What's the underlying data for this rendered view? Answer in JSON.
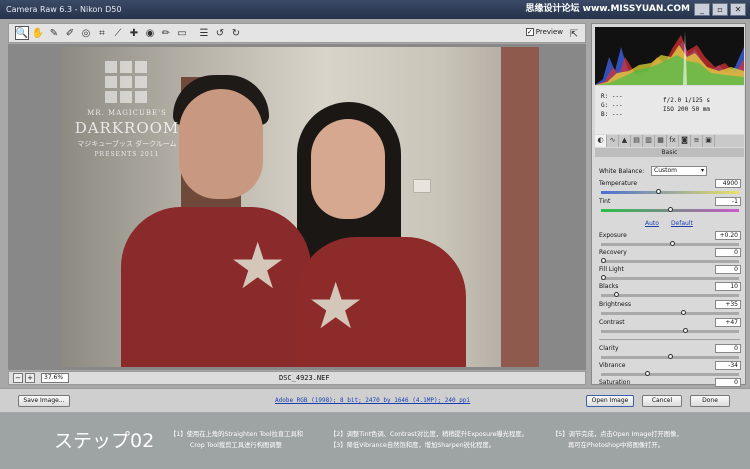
{
  "window": {
    "title": "Camera Raw 6.3  -  Nikon D50",
    "watermark": "思缘设计论坛 www.MISSYUAN.COM",
    "close": "✕",
    "minimize": "_",
    "maximize": "▫"
  },
  "toolbar": {
    "tools": [
      "zoom-icon",
      "hand-icon",
      "white-balance-icon",
      "color-sampler-icon",
      "target-adjust-icon",
      "crop-icon",
      "straighten-icon",
      "spot-removal-icon",
      "red-eye-icon",
      "adjustment-brush-icon",
      "graduated-filter-icon",
      "preferences-icon",
      "rotate-ccw-icon",
      "rotate-cw-icon"
    ],
    "preview_label": "Preview",
    "preview_checked": true
  },
  "photo_logo": {
    "line1": "MR. MAGICUBE'S",
    "line2": "DARKROOM",
    "line3": "マジキューブッス ダークルーム",
    "line4": "PRESENTS 2011"
  },
  "statusbar": {
    "zoom": "37.6%",
    "filename": "DSC_4923.NEF"
  },
  "readout": {
    "r": "R:  ---",
    "g": "G:  ---",
    "b": "B:  ---",
    "aperture_shutter": "f/2.0   1/125 s",
    "iso_focal": "ISO 200   50 mm"
  },
  "panel": {
    "section": "Basic",
    "white_balance_label": "White Balance:",
    "white_balance_value": "Custom",
    "auto": "Auto",
    "default": "Default",
    "controls": [
      {
        "label": "Temperature",
        "value": "4900",
        "pos": 0.41
      },
      {
        "label": "Tint",
        "value": "-1",
        "pos": 0.5
      },
      {
        "label": "Exposure",
        "value": "+0.20",
        "pos": 0.52
      },
      {
        "label": "Recovery",
        "value": "0",
        "pos": 0.0
      },
      {
        "label": "Fill Light",
        "value": "0",
        "pos": 0.0
      },
      {
        "label": "Blacks",
        "value": "10",
        "pos": 0.1
      },
      {
        "label": "Brightness",
        "value": "+35",
        "pos": 0.6
      },
      {
        "label": "Contrast",
        "value": "+47",
        "pos": 0.62
      },
      {
        "label": "Clarity",
        "value": "0",
        "pos": 0.5
      },
      {
        "label": "Vibrance",
        "value": "-34",
        "pos": 0.33
      },
      {
        "label": "Saturation",
        "value": "0",
        "pos": 0.5
      }
    ]
  },
  "buttons": {
    "save": "Save Image...",
    "open": "Open Image",
    "cancel": "Cancel",
    "done": "Done"
  },
  "workflow_link": "Adobe RGB (1998); 8 bit; 2470 by 1646 (4.1MP); 240 ppi",
  "footer": {
    "step": "ステップ02",
    "note1a": "【1】使用在上角的Straighten Tool拉直工具和",
    "note1b": "Crop Tool裁剪工具进行构图调整",
    "note2a": "【2】调整Tint色调、Contrast对比度，稍稍提升Exposure曝光程度。",
    "note2b": "【3】降低Vibrance自然饱和度，增加Sharpen锐化程度。",
    "note3a": "【5】调节完成，点击Open Image打开图像，",
    "note3b": "再可在Photoshop中将图像打开。"
  }
}
